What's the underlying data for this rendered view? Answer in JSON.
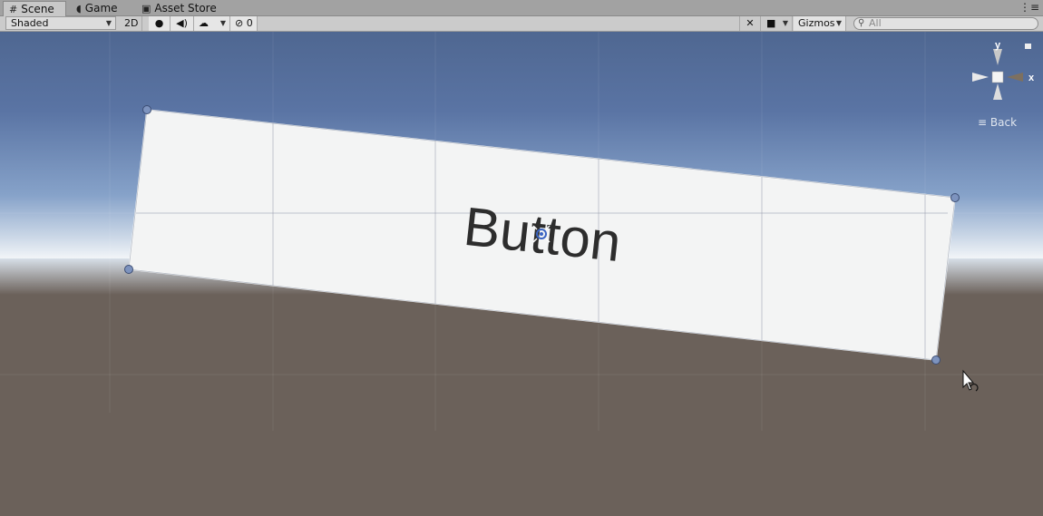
{
  "tabs": [
    {
      "label": "Scene",
      "icon": "grid-icon",
      "active": true
    },
    {
      "label": "Game",
      "icon": "pacman-icon",
      "active": false
    },
    {
      "label": "Asset Store",
      "icon": "store-bag-icon",
      "active": false
    }
  ],
  "toolbar": {
    "shading_mode": "Shaded",
    "mode_2d": "2D",
    "hidden_count": "0",
    "gizmos_label": "Gizmos",
    "search_placeholder": "All"
  },
  "scene": {
    "button_text": "Button",
    "gizmo": {
      "y_label": "y",
      "x_label": "x",
      "projection_label": "Back"
    }
  },
  "colors": {
    "sky_top": "#4f6791",
    "sky_horizon": "#c9d6e6",
    "ground": "#6b615a",
    "button_fill": "#f3f4f4",
    "handle": "#7d93be"
  }
}
